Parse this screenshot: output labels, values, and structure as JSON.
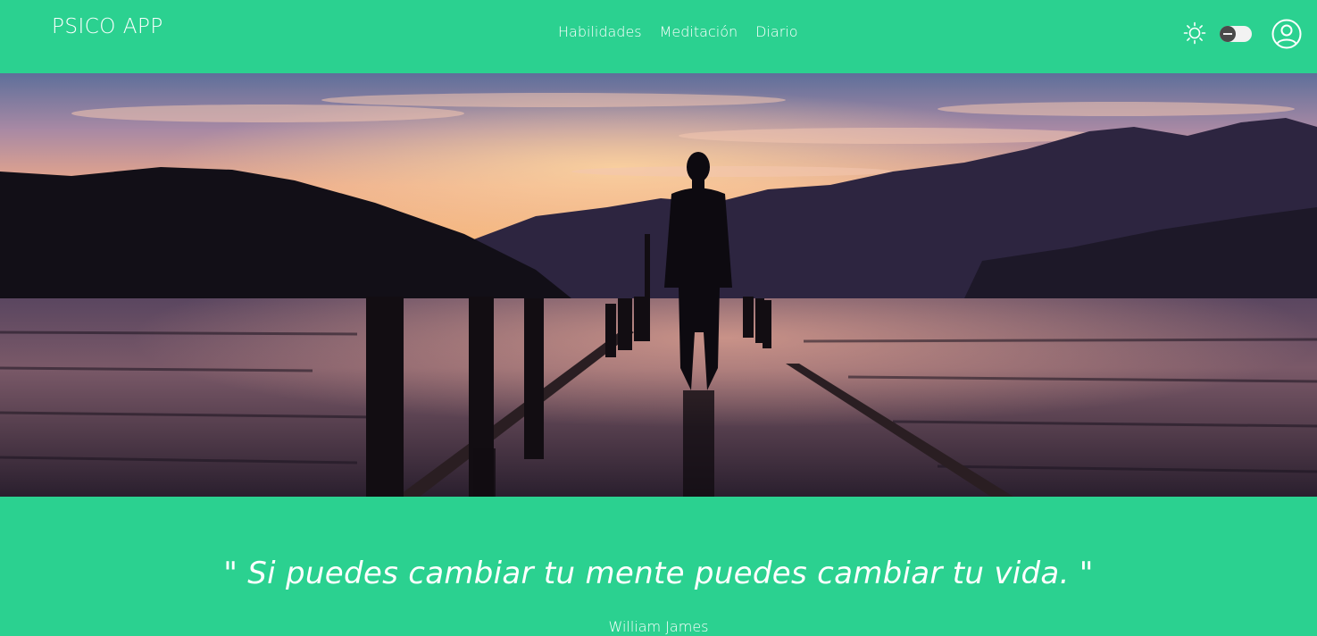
{
  "navbar": {
    "brand": "PSICO APP",
    "links": [
      "Habilidades",
      "Meditación",
      "Diario"
    ],
    "icons": [
      "sun-icon",
      "theme-toggle",
      "user-account-icon"
    ]
  },
  "hero": {
    "image": "silhouette of a person standing on a flooded pier at sunset over a lake with mountains"
  },
  "quote": {
    "text": "\" Si puedes cambiar tu mente puedes cambiar tu vida. \"",
    "author": "William James"
  },
  "colors": {
    "accent": "#2bd190"
  }
}
